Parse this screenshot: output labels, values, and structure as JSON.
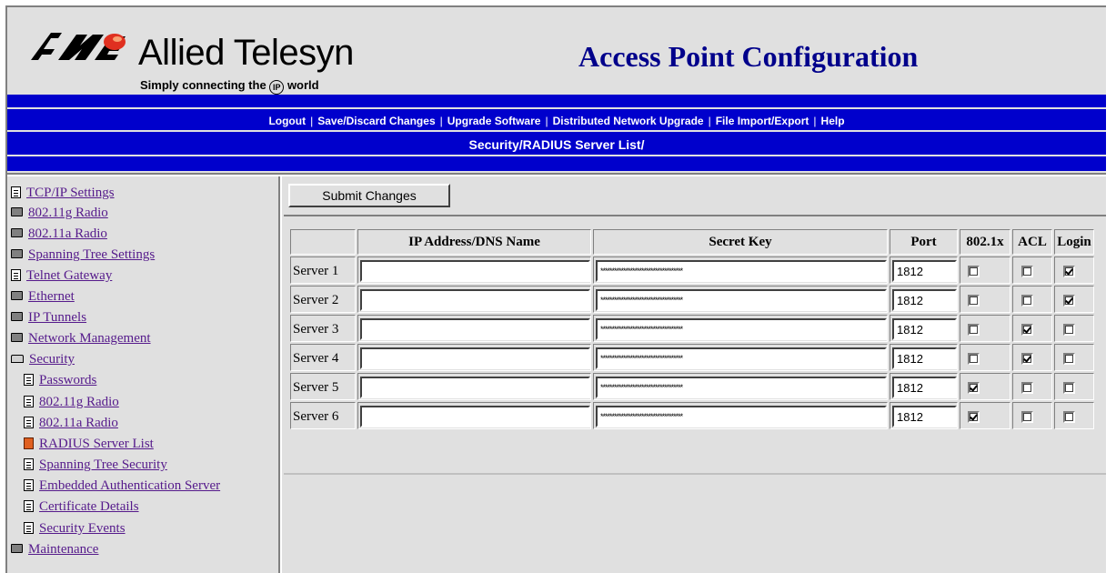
{
  "header": {
    "brand": "Allied Telesyn",
    "tagline_pre": "Simply connecting the",
    "tagline_ip": "IP",
    "tagline_post": "world",
    "title": "Access Point Configuration"
  },
  "nav": {
    "links": [
      "Logout",
      "Save/Discard Changes",
      "Upgrade Software",
      "Distributed Network Upgrade",
      "File Import/Export",
      "Help"
    ],
    "breadcrumb": "Security/RADIUS Server List/"
  },
  "sidebar": {
    "items": [
      {
        "label": "TCP/IP Settings",
        "icon": "page-icon"
      },
      {
        "label": "802.11g Radio",
        "icon": "folder-icon"
      },
      {
        "label": "802.11a Radio",
        "icon": "folder-icon"
      },
      {
        "label": "Spanning Tree Settings",
        "icon": "folder-icon"
      },
      {
        "label": "Telnet Gateway",
        "icon": "page-icon"
      },
      {
        "label": "Ethernet",
        "icon": "folder-icon"
      },
      {
        "label": "IP Tunnels",
        "icon": "folder-icon"
      },
      {
        "label": "Network Management",
        "icon": "folder-icon"
      },
      {
        "label": "Security",
        "icon": "folder-open-icon"
      },
      {
        "label": "Passwords",
        "icon": "page-icon"
      },
      {
        "label": "802.11g Radio",
        "icon": "page-icon"
      },
      {
        "label": "802.11a Radio",
        "icon": "page-icon"
      },
      {
        "label": "RADIUS Server List",
        "icon": "page-icon",
        "active": true
      },
      {
        "label": "Spanning Tree Security",
        "icon": "page-icon"
      },
      {
        "label": "Embedded Authentication Server",
        "icon": "page-icon"
      },
      {
        "label": "Certificate Details",
        "icon": "page-icon"
      },
      {
        "label": "Security Events",
        "icon": "page-icon"
      },
      {
        "label": "Maintenance",
        "icon": "folder-icon"
      }
    ]
  },
  "main": {
    "submit_label": "Submit Changes",
    "columns": [
      "",
      "IP Address/DNS Name",
      "Secret Key",
      "Port",
      "802.1x",
      "ACL",
      "Login"
    ],
    "rows": [
      {
        "label": "Server 1",
        "ip": "",
        "secret": "************************************",
        "port": "1812",
        "dot1x": false,
        "acl": false,
        "login": true
      },
      {
        "label": "Server 2",
        "ip": "",
        "secret": "************************************",
        "port": "1812",
        "dot1x": false,
        "acl": false,
        "login": true
      },
      {
        "label": "Server 3",
        "ip": "",
        "secret": "************************************",
        "port": "1812",
        "dot1x": false,
        "acl": true,
        "login": false
      },
      {
        "label": "Server 4",
        "ip": "",
        "secret": "************************************",
        "port": "1812",
        "dot1x": false,
        "acl": true,
        "login": false
      },
      {
        "label": "Server 5",
        "ip": "",
        "secret": "************************************",
        "port": "1812",
        "dot1x": true,
        "acl": false,
        "login": false
      },
      {
        "label": "Server 6",
        "ip": "",
        "secret": "************************************",
        "port": "1812",
        "dot1x": true,
        "acl": false,
        "login": false
      }
    ]
  },
  "colors": {
    "nav_blue": "#0000cc",
    "title_blue": "#00008b",
    "link_purple": "#551a8b",
    "bg_gray": "#e0e0e0"
  }
}
